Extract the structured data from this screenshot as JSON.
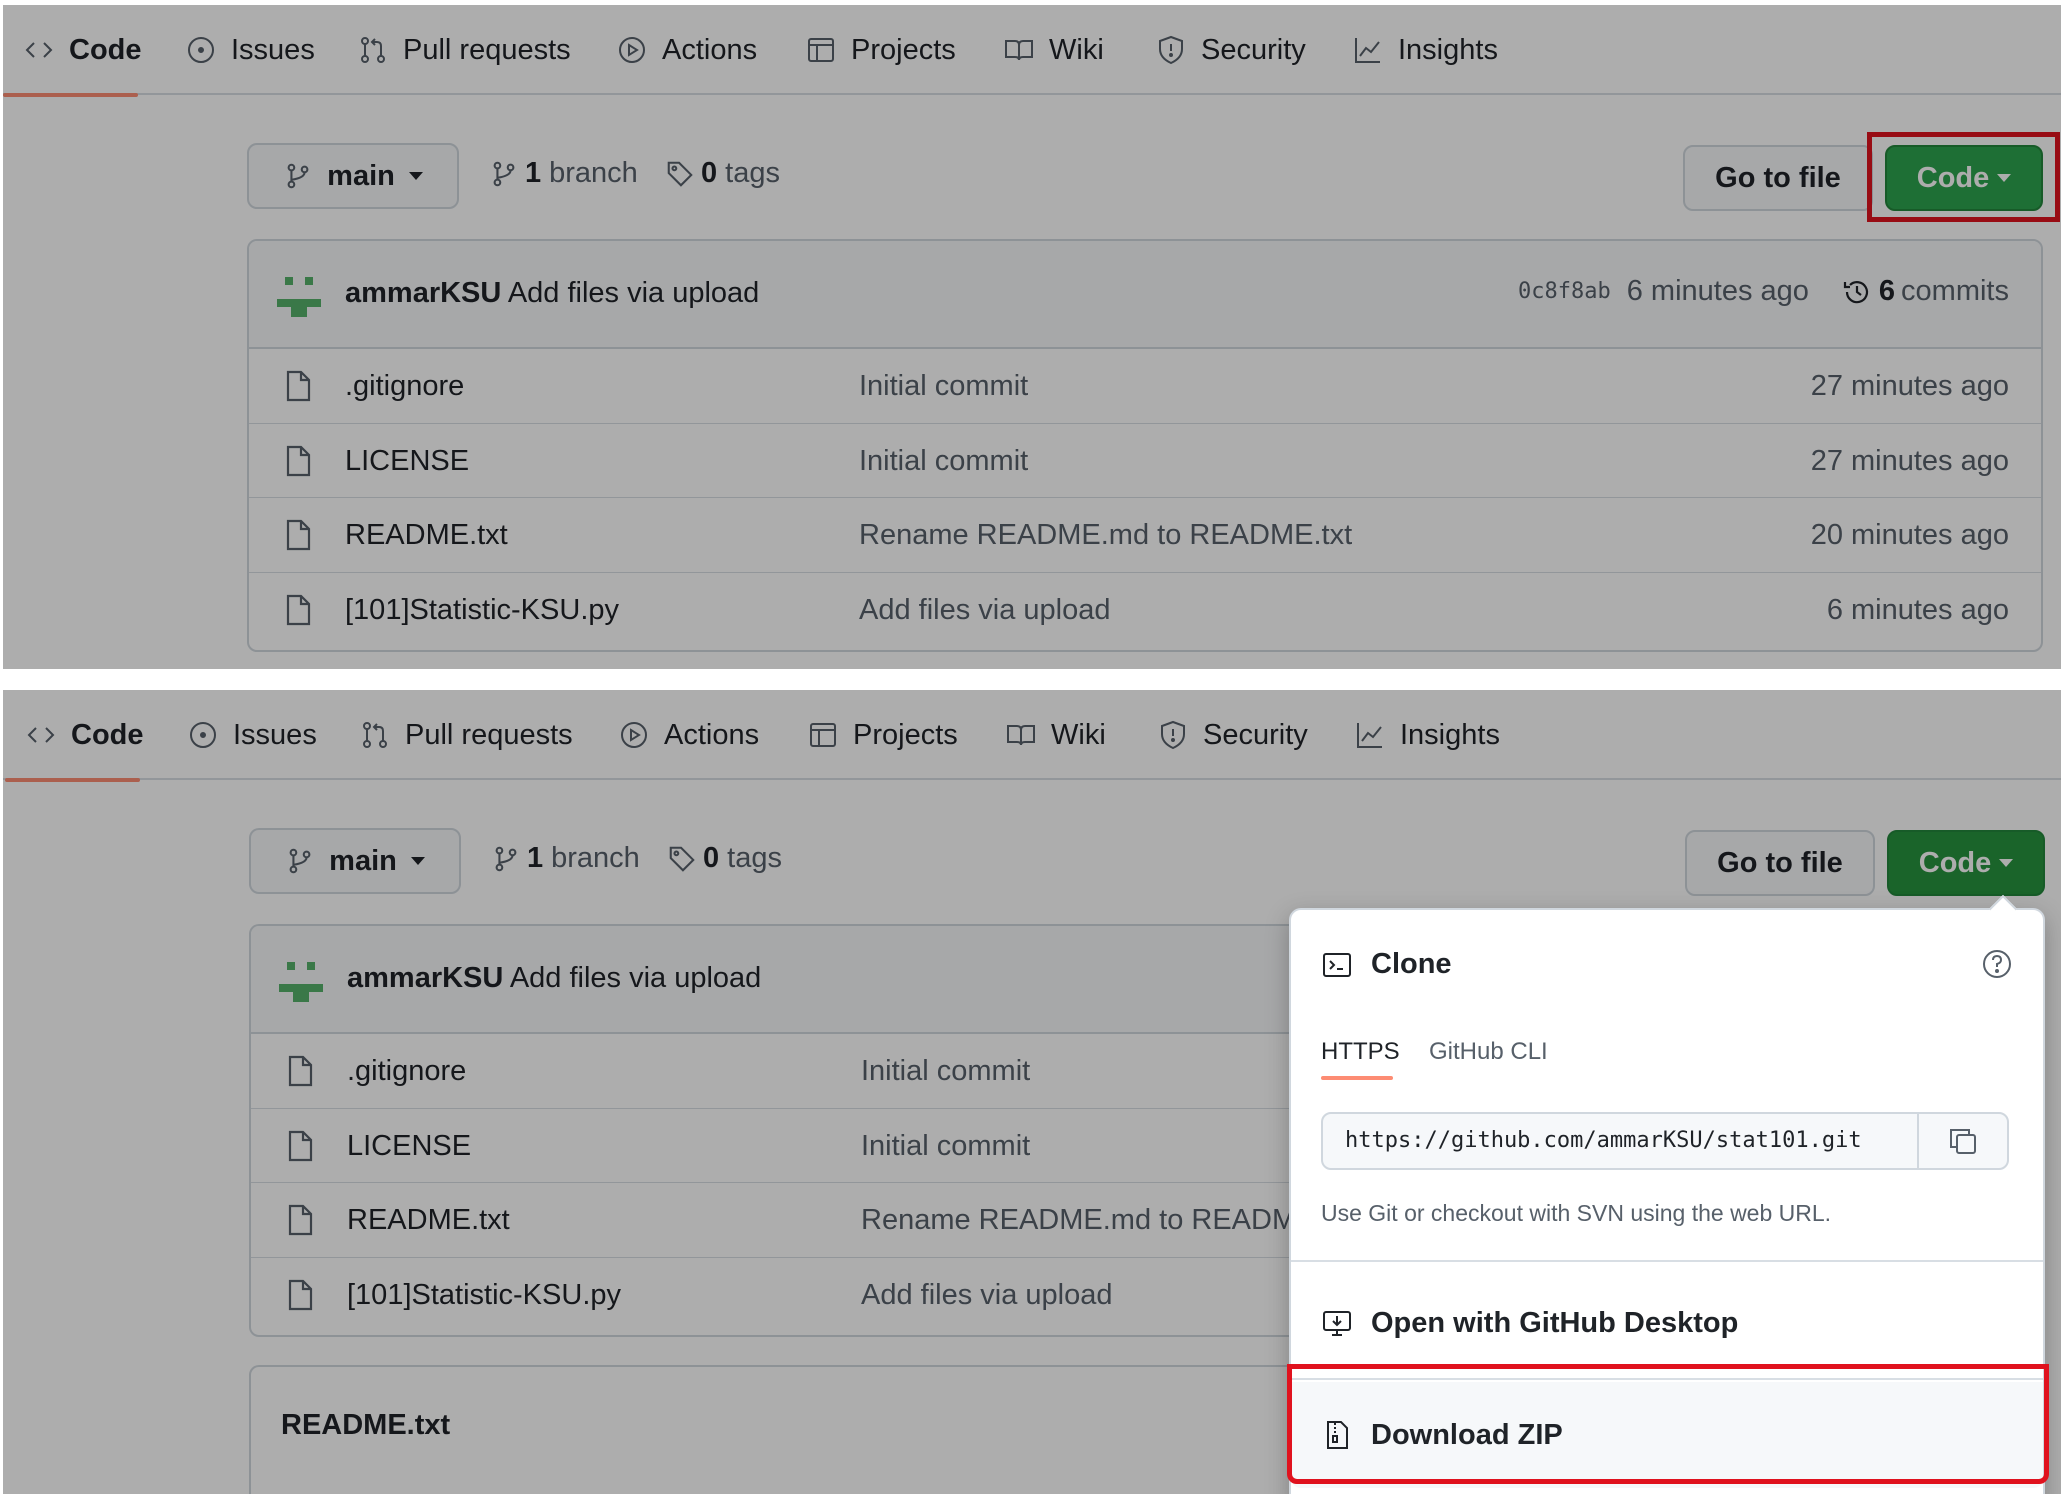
{
  "nav": {
    "items": [
      {
        "label": "Code",
        "icon": "code-icon"
      },
      {
        "label": "Issues",
        "icon": "issue-icon"
      },
      {
        "label": "Pull requests",
        "icon": "pull-request-icon"
      },
      {
        "label": "Actions",
        "icon": "play-icon"
      },
      {
        "label": "Projects",
        "icon": "table-icon"
      },
      {
        "label": "Wiki",
        "icon": "book-icon"
      },
      {
        "label": "Security",
        "icon": "shield-icon"
      },
      {
        "label": "Insights",
        "icon": "graph-icon"
      }
    ]
  },
  "toolbar": {
    "branch_label": "main",
    "branch_count": "1",
    "branch_word": "branch",
    "tag_count": "0",
    "tag_word": "tags",
    "go_to_file": "Go to file",
    "code_button": "Code"
  },
  "latest_commit": {
    "author": "ammarKSU",
    "message": "Add files via upload",
    "sha": "0c8f8ab",
    "age": "6 minutes ago",
    "commit_count": "6",
    "commit_word": "commits"
  },
  "files": [
    {
      "name": ".gitignore",
      "commit": "Initial commit",
      "age": "27 minutes ago"
    },
    {
      "name": "LICENSE",
      "commit": "Initial commit",
      "age": "27 minutes ago"
    },
    {
      "name": "README.txt",
      "commit": "Rename README.md to README.txt",
      "age": "20 minutes ago"
    },
    {
      "name": "[101]Statistic-KSU.py",
      "commit": "Add files via upload",
      "age": "6 minutes ago"
    }
  ],
  "truncated_commit": "Rename README.md to README.t",
  "clone_menu": {
    "title": "Clone",
    "tabs": [
      "HTTPS",
      "GitHub CLI"
    ],
    "url": "https://github.com/ammarKSU/stat101.git",
    "hint": "Use Git or checkout with SVN using the web URL.",
    "open_desktop": "Open with GitHub Desktop",
    "download_zip": "Download ZIP"
  },
  "readme": {
    "title": "README.txt"
  },
  "colors": {
    "accent": "#fd8c73",
    "green": "#2da44e",
    "highlight": "#e0121e"
  }
}
